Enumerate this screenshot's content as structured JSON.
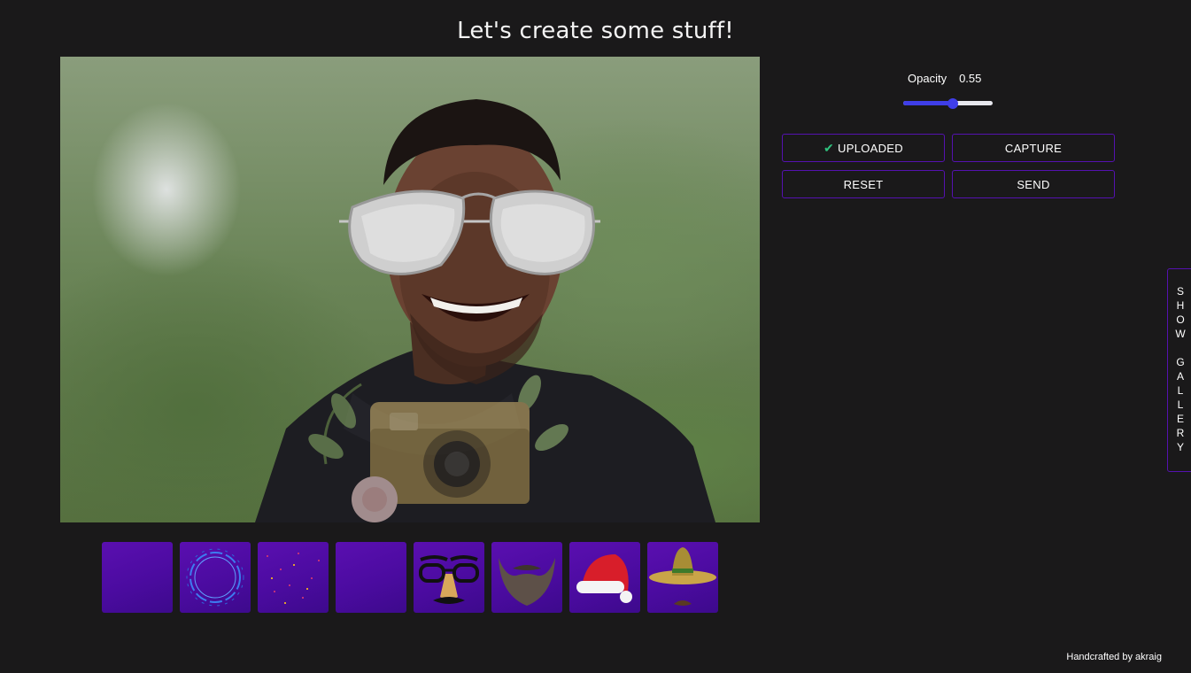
{
  "header": {
    "title": "Let's create some stuff!"
  },
  "controls": {
    "opacity_label": "Opacity",
    "opacity_value": "0.55",
    "opacity_level": 0.55
  },
  "buttons": {
    "uploaded": "UPLOADED",
    "capture": "CAPTURE",
    "reset": "RESET",
    "send": "SEND"
  },
  "gallery_toggle": {
    "label": "SHOW GALLERY"
  },
  "stickers": [
    {
      "name": "blank-purple"
    },
    {
      "name": "circle-frame"
    },
    {
      "name": "confetti"
    },
    {
      "name": "blank-purple"
    },
    {
      "name": "groucho-glasses"
    },
    {
      "name": "beard"
    },
    {
      "name": "santa-hat"
    },
    {
      "name": "sombrero"
    }
  ],
  "footer": {
    "credit": "Handcrafted by akraig"
  },
  "colors": {
    "accent": "#5511b0",
    "slider": "#3f3ee8",
    "check": "#2ec27e",
    "background": "#1a191a"
  }
}
